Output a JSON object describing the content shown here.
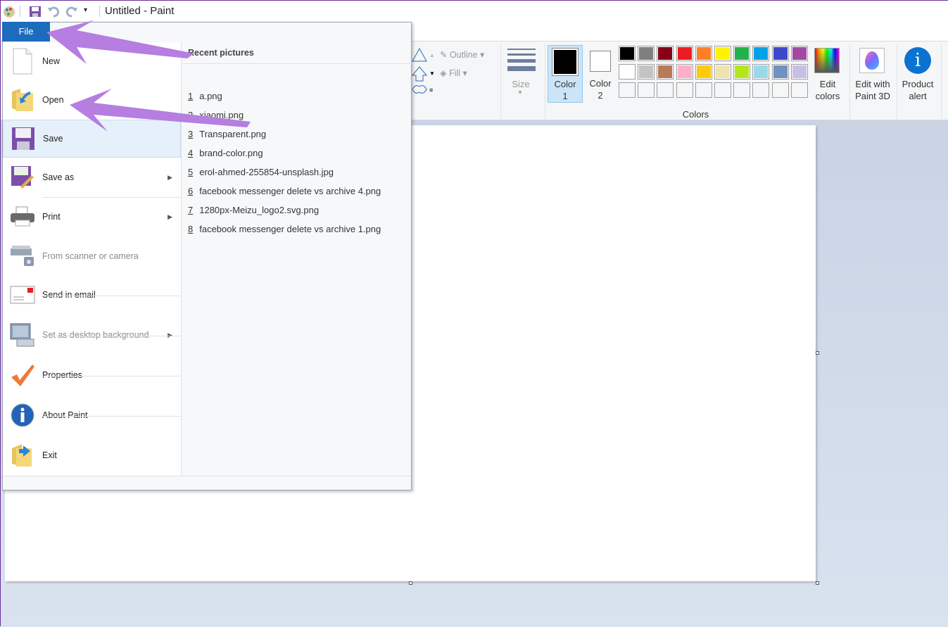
{
  "window": {
    "title": "Untitled - Paint",
    "border_color": "#6b2fa0"
  },
  "qat": {
    "icons": [
      "paint-app-icon",
      "save-icon",
      "undo-icon",
      "redo-icon",
      "customize-dropdown-icon"
    ]
  },
  "file_tab": {
    "label": "File",
    "color": "#1d6bbd"
  },
  "ribbon": {
    "outline": "Outline",
    "fill": "Fill",
    "shapes_group": "s",
    "size": "Size",
    "color1": {
      "label": "Color",
      "num": "1"
    },
    "color2": {
      "label": "Color",
      "num": "2"
    },
    "edit_colors": {
      "line1": "Edit",
      "line2": "colors"
    },
    "paint3d": {
      "line1": "Edit with",
      "line2": "Paint 3D"
    },
    "product_alert": {
      "line1": "Product",
      "line2": "alert"
    },
    "colors_group": "Colors",
    "palette_row1": [
      "#000000",
      "#7f7f7f",
      "#880015",
      "#ed1c24",
      "#ff7f27",
      "#fff200",
      "#22b14c",
      "#00a2e8",
      "#3f48cc",
      "#a349a4"
    ],
    "palette_row2": [
      "#ffffff",
      "#c3c3c3",
      "#b97a57",
      "#ffaec9",
      "#ffc90e",
      "#efe4b0",
      "#b5e61d",
      "#99d9ea",
      "#7092be",
      "#c8bfe7"
    ]
  },
  "menu": {
    "items": [
      {
        "label": "New",
        "icon": "new-file-icon",
        "disabled": false
      },
      {
        "label": "Open",
        "icon": "open-folder-icon",
        "disabled": false
      },
      {
        "label": "Save",
        "icon": "save-icon",
        "disabled": false,
        "selected": true
      },
      {
        "label": "Save as",
        "icon": "save-as-icon",
        "disabled": false,
        "submenu": true
      },
      {
        "label": "Print",
        "icon": "printer-icon",
        "disabled": false,
        "submenu": true
      },
      {
        "label": "From scanner or camera",
        "icon": "scanner-icon",
        "disabled": true
      },
      {
        "label": "Send in email",
        "icon": "email-icon",
        "disabled": false
      },
      {
        "label": "Set as desktop background",
        "icon": "desktop-icon",
        "disabled": true,
        "submenu": true
      },
      {
        "label": "Properties",
        "icon": "checkmark-icon",
        "disabled": false
      },
      {
        "label": "About Paint",
        "icon": "info-icon",
        "disabled": false
      },
      {
        "label": "Exit",
        "icon": "exit-icon",
        "disabled": false
      }
    ],
    "recent_title": "Recent pictures",
    "recent": [
      {
        "num": "1",
        "name": "a.png"
      },
      {
        "num": "2",
        "name": "xiaomi.png"
      },
      {
        "num": "3",
        "name": "Transparent.png"
      },
      {
        "num": "4",
        "name": "brand-color.png"
      },
      {
        "num": "5",
        "name": "erol-ahmed-255854-unsplash.jpg"
      },
      {
        "num": "6",
        "name": "facebook messenger delete vs archive 4.png"
      },
      {
        "num": "7",
        "name": "1280px-Meizu_logo2.svg.png"
      },
      {
        "num": "8",
        "name": "facebook messenger delete vs archive 1.png"
      }
    ]
  },
  "annotation_color": "#b57ee0"
}
